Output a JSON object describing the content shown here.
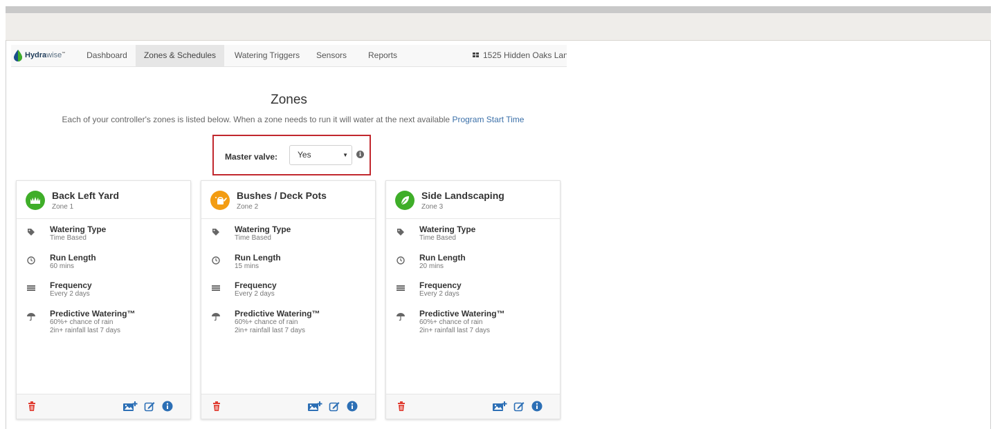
{
  "nav": {
    "brand_bold": "Hydra",
    "brand_light": "wise",
    "brand_tm": "™",
    "items": [
      {
        "label": "Dashboard"
      },
      {
        "label": "Zones & Schedules",
        "active": true
      },
      {
        "label": "Watering Triggers"
      },
      {
        "label": "Sensors"
      },
      {
        "label": "Reports"
      }
    ],
    "controller": "1525 Hidden Oaks Lan"
  },
  "page": {
    "title": "Zones",
    "subtitle": "Each of your controller's zones is listed below. When a zone needs to run it will water at the next available",
    "subtitle_link": "Program Start Time"
  },
  "master_valve": {
    "label": "Master valve:",
    "value": "Yes",
    "caret": "▼",
    "info": "i"
  },
  "row_labels": {
    "type": "Watering Type",
    "run": "Run Length",
    "freq": "Frequency",
    "predictive": "Predictive Watering™"
  },
  "zones": [
    {
      "name": "Back Left Yard",
      "zone": "Zone 1",
      "icon": "grass-icon",
      "icon_color": "#3fae29",
      "watering_type": "Time Based",
      "run_length": "60 mins",
      "frequency": "Every 2 days",
      "predictive_1": "60%+ chance of rain",
      "predictive_2": "2in+ rainfall last 7 days"
    },
    {
      "name": "Bushes / Deck Pots",
      "zone": "Zone 2",
      "icon": "watering-can-icon",
      "icon_color": "#f39c12",
      "watering_type": "Time Based",
      "run_length": "15 mins",
      "frequency": "Every 2 days",
      "predictive_1": "60%+ chance of rain",
      "predictive_2": "2in+ rainfall last 7 days"
    },
    {
      "name": "Side Landscaping",
      "zone": "Zone 3",
      "icon": "leaf-icon",
      "icon_color": "#3fae29",
      "watering_type": "Time Based",
      "run_length": "20 mins",
      "frequency": "Every 2 days",
      "predictive_1": "60%+ chance of rain",
      "predictive_2": "2in+ rainfall last 7 days"
    }
  ],
  "colors": {
    "accent_blue": "#2c6fb5",
    "trash_red": "#e03c31",
    "highlight_red": "#c1272d"
  }
}
